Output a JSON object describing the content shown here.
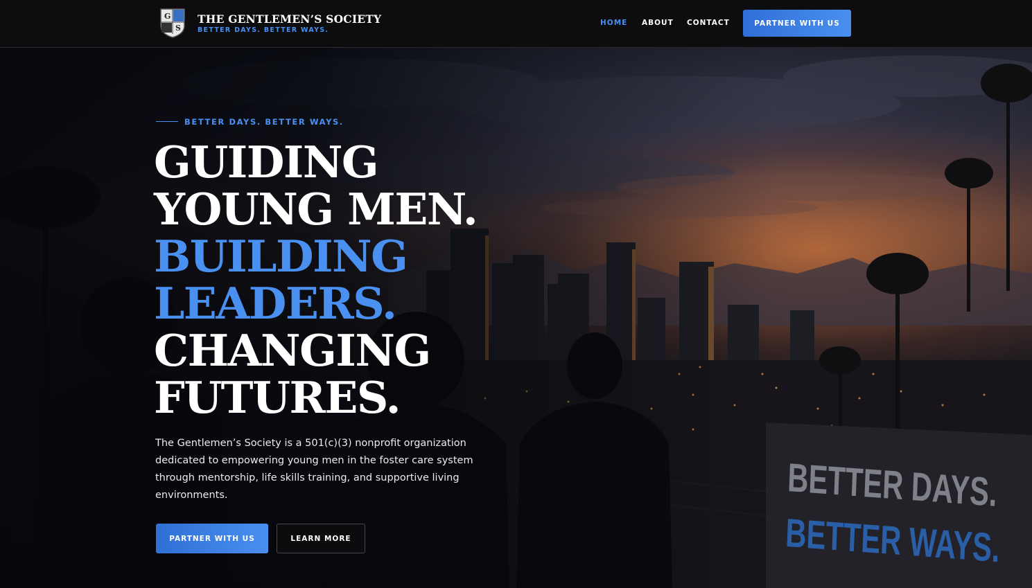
{
  "brand": {
    "monogram": "GS",
    "name": "THE GENTLEMEN’S SOCIETY",
    "tagline": "BETTER DAYS. BETTER WAYS."
  },
  "nav": {
    "items": [
      {
        "label": "HOME",
        "active": true
      },
      {
        "label": "ABOUT",
        "active": false
      },
      {
        "label": "CONTACT",
        "active": false
      }
    ],
    "cta_label": "PARTNER WITH US"
  },
  "hero": {
    "eyebrow": "BETTER DAYS. BETTER WAYS.",
    "headline_lines": [
      {
        "text": "GUIDING",
        "accent": false
      },
      {
        "text": "YOUNG MEN.",
        "accent": false
      },
      {
        "text": "BUILDING",
        "accent": true
      },
      {
        "text": "LEADERS.",
        "accent": true
      },
      {
        "text": "CHANGING",
        "accent": false
      },
      {
        "text": "FUTURES.",
        "accent": false
      }
    ],
    "description": "The Gentlemen’s Society is a 501(c)(3) nonprofit organization dedicated to empowering young men in the foster care system through mentorship, life skills training, and supportive living environments.",
    "primary_button": "PARTNER WITH US",
    "secondary_button": "LEARN MORE",
    "wall_text_line1": "BETTER DAYS.",
    "wall_text_line2": "BETTER WAYS."
  },
  "colors": {
    "accent": "#4a90f0",
    "navbar_bg": "#0d0d0f",
    "text": "#ffffff"
  }
}
